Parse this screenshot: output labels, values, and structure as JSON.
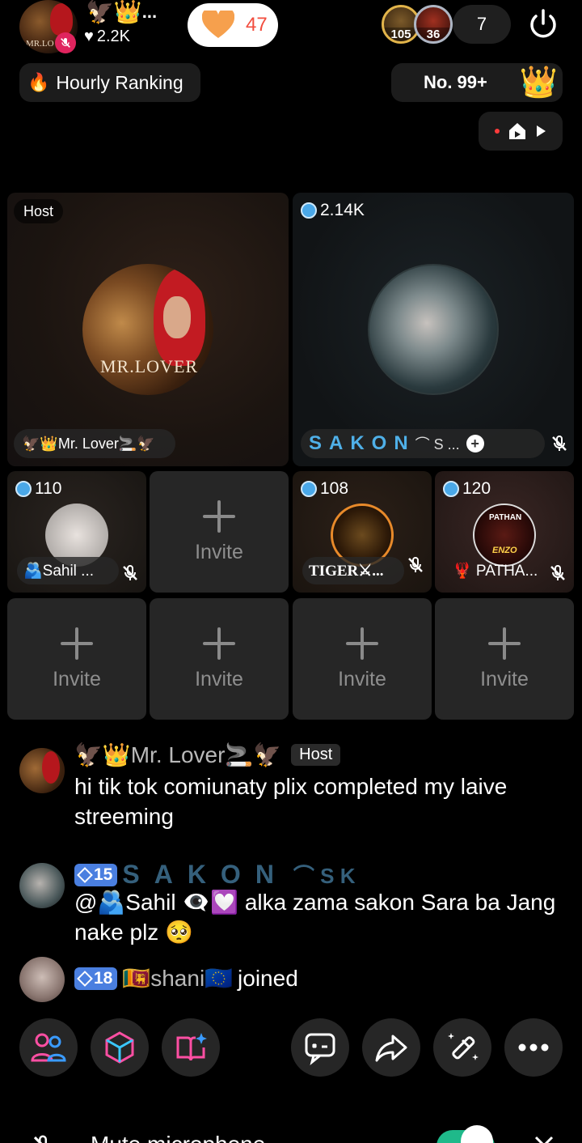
{
  "header": {
    "host_emoji": "🦅👑",
    "host_more": "...",
    "host_likes": "2.2K",
    "gift_count": "47",
    "viewer_levels": [
      "105",
      "36"
    ],
    "viewer_count": "7",
    "hourly_label": "Hourly Ranking",
    "rank_label": "No. 99+",
    "host_avatar_text": "MR.LO"
  },
  "seats": {
    "host": {
      "tag": "Host",
      "name": "🦅👑Mr. Lover🚬🦅",
      "avatar_text": "MR.LOVER"
    },
    "guest1": {
      "coins": "2.14K",
      "name_styled": "SAKON",
      "name_tail": "⌒ S ...",
      "name": "S A K O N ⌒ S ..."
    },
    "small": [
      {
        "coins": "110",
        "name": "🫂Sahil ..."
      },
      {
        "invite": "Invite"
      },
      {
        "coins": "108",
        "name": "TIGER⚔..."
      },
      {
        "coins": "120",
        "name": "🦞 PATHA...",
        "avatar_t1": "PATHAN",
        "avatar_t2": "ENZO"
      },
      {
        "invite": "Invite"
      },
      {
        "invite": "Invite"
      },
      {
        "invite": "Invite"
      },
      {
        "invite": "Invite"
      }
    ]
  },
  "chat": [
    {
      "name": "🦅👑Mr. Lover🚬🦅",
      "badge": "Host",
      "text": "hi tik tok comiunaty plix completed my laive streeming"
    },
    {
      "level": "15",
      "name_styled": "SAKON",
      "name_tail": "⌒ S K",
      "text": "@🫂Sahil 👁‍🗨💟 alka zama sakon Sara ba Jang nake plz 🥺"
    },
    {
      "level": "18",
      "name": "🇱🇰shani🇪🇺",
      "text": "joined"
    }
  ],
  "footer": {
    "mute_label": "Mute microphone"
  },
  "colors": {
    "accent_blue": "#4fb0e8",
    "gift_red": "#f24d3e",
    "toggle_green": "#1fb98a",
    "mute_pink": "#e0245e"
  }
}
